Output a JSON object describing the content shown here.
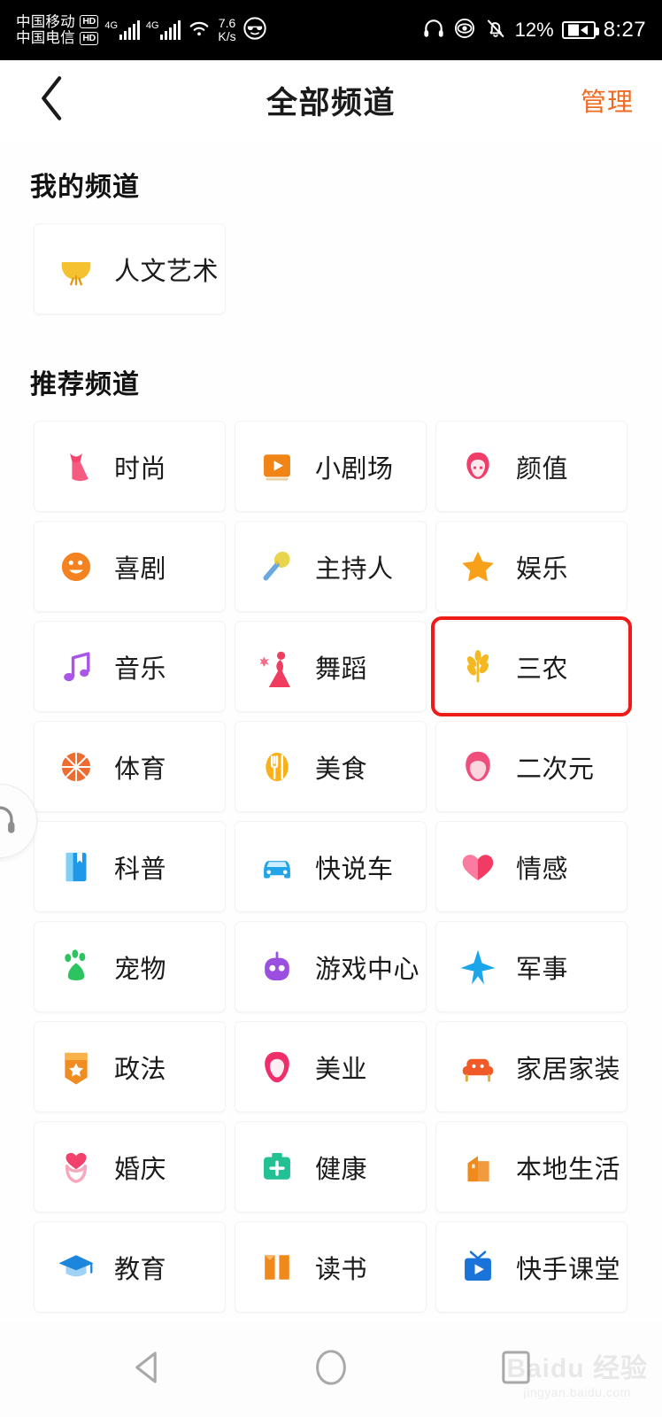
{
  "status_bar": {
    "carrier_1": "中国移动",
    "carrier_2": "中国电信",
    "hd_badge_1": "HD",
    "hd_badge_2": "HD",
    "network_1": "4G",
    "network_2": "4G",
    "net_speed_value": "7.6",
    "net_speed_unit": "K/s",
    "battery_percent": "12%",
    "time": "8:27",
    "icons": [
      "wifi-icon",
      "sunglasses-emoji-icon",
      "headphone-icon",
      "eye-icon",
      "bell-muted-icon",
      "battery-charging-icon"
    ]
  },
  "header": {
    "back_icon": "chevron-left-icon",
    "title": "全部频道",
    "manage_label": "管理",
    "manage_color": "#f06a21"
  },
  "my_channels": {
    "title": "我的频道",
    "items": [
      {
        "label": "人文艺术",
        "icon": "fan-icon",
        "color": "#f5c130"
      }
    ]
  },
  "recommended_channels": {
    "title": "推荐频道",
    "items": [
      {
        "label": "时尚",
        "icon": "dress-icon",
        "color": "#f5456e",
        "highlighted": false
      },
      {
        "label": "小剧场",
        "icon": "video-play-icon",
        "color": "#f08416",
        "highlighted": false
      },
      {
        "label": "颜值",
        "icon": "face-beauty-icon",
        "color": "#f03c68",
        "highlighted": false
      },
      {
        "label": "喜剧",
        "icon": "smiley-icon",
        "color": "#f58220",
        "highlighted": false
      },
      {
        "label": "主持人",
        "icon": "microphone-icon",
        "color": "#e8d44d",
        "highlighted": false
      },
      {
        "label": "娱乐",
        "icon": "star-icon",
        "color": "#f9a01b",
        "highlighted": false
      },
      {
        "label": "音乐",
        "icon": "music-note-icon",
        "color": "#a855e8",
        "highlighted": false
      },
      {
        "label": "舞蹈",
        "icon": "dancer-icon",
        "color": "#f03c5e",
        "highlighted": false
      },
      {
        "label": "三农",
        "icon": "wheat-icon",
        "color": "#f5b820",
        "highlighted": true
      },
      {
        "label": "体育",
        "icon": "basketball-icon",
        "color": "#ed6c30",
        "highlighted": false
      },
      {
        "label": "美食",
        "icon": "food-icon",
        "color": "#f9b019",
        "highlighted": false
      },
      {
        "label": "二次元",
        "icon": "anime-face-icon",
        "color": "#ef4f7c",
        "highlighted": false
      },
      {
        "label": "科普",
        "icon": "book-blue-icon",
        "color": "#1e98e8",
        "highlighted": false
      },
      {
        "label": "快说车",
        "icon": "car-icon",
        "color": "#22a5e8",
        "highlighted": false
      },
      {
        "label": "情感",
        "icon": "heart-icon",
        "color": "#f23b63",
        "highlighted": false
      },
      {
        "label": "宠物",
        "icon": "paw-icon",
        "color": "#2cc45e",
        "highlighted": false
      },
      {
        "label": "游戏中心",
        "icon": "robot-icon",
        "color": "#9b4fe0",
        "highlighted": false
      },
      {
        "label": "军事",
        "icon": "jet-icon",
        "color": "#1ba6ec",
        "highlighted": false
      },
      {
        "label": "政法",
        "icon": "shield-badge-icon",
        "color": "#f08c22",
        "highlighted": false
      },
      {
        "label": "美业",
        "icon": "lips-icon",
        "color": "#ef2f6b",
        "highlighted": false
      },
      {
        "label": "家居家装",
        "icon": "sofa-icon",
        "color": "#ef5a28",
        "highlighted": false
      },
      {
        "label": "婚庆",
        "icon": "ring-heart-icon",
        "color": "#f2426b",
        "highlighted": false
      },
      {
        "label": "健康",
        "icon": "medkit-icon",
        "color": "#22c194",
        "highlighted": false
      },
      {
        "label": "本地生活",
        "icon": "buildings-icon",
        "color": "#f08a1c",
        "highlighted": false
      },
      {
        "label": "教育",
        "icon": "graduation-cap-icon",
        "color": "#1c86dd",
        "highlighted": false
      },
      {
        "label": "读书",
        "icon": "open-book-icon",
        "color": "#f0881c",
        "highlighted": false
      },
      {
        "label": "快手课堂",
        "icon": "tv-play-icon",
        "color": "#1a73d8",
        "highlighted": false
      }
    ]
  },
  "floating_button": {
    "icon": "headphone-icon"
  },
  "nav_bar": {
    "items": [
      {
        "icon": "triangle-back-icon"
      },
      {
        "icon": "circle-home-icon"
      },
      {
        "icon": "square-recents-icon"
      }
    ]
  },
  "watermark": {
    "main": "Baidu 经验",
    "sub": "jingyan.baidu.com"
  }
}
